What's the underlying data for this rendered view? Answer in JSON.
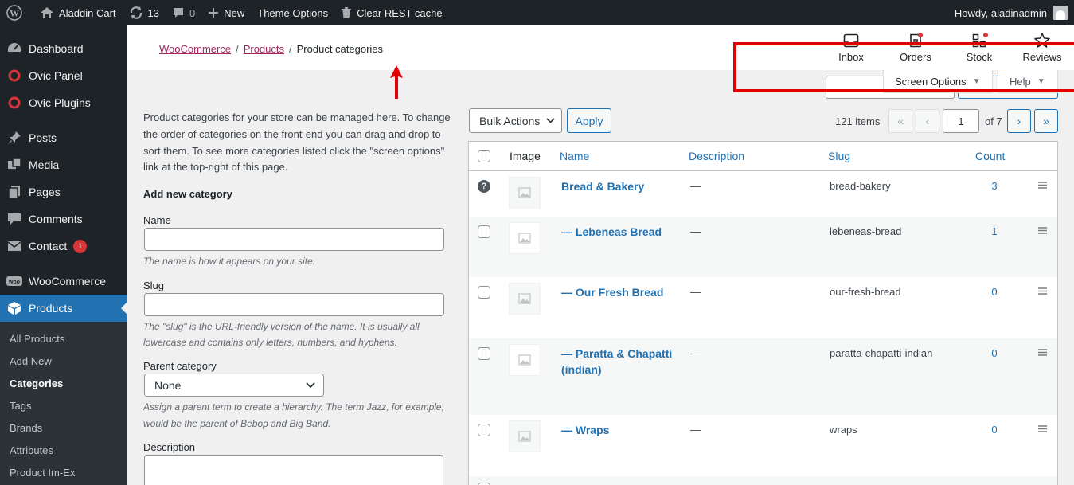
{
  "admin_bar": {
    "site_name": "Aladdin Cart",
    "updates_count": "13",
    "comments_count": "0",
    "new_label": "New",
    "theme_options": "Theme Options",
    "clear_cache": "Clear REST cache",
    "greeting": "Howdy, aladinadmin"
  },
  "sidebar": {
    "items": [
      {
        "label": "Dashboard",
        "icon": "dashboard-icon"
      },
      {
        "label": "Ovic Panel",
        "icon": "ovic-icon"
      },
      {
        "label": "Ovic Plugins",
        "icon": "ovic-icon"
      },
      {
        "label": "Posts",
        "icon": "pin-icon"
      },
      {
        "label": "Media",
        "icon": "media-icon"
      },
      {
        "label": "Pages",
        "icon": "pages-icon"
      },
      {
        "label": "Comments",
        "icon": "comment-icon"
      },
      {
        "label": "Contact",
        "icon": "mail-icon",
        "badge": "1"
      },
      {
        "label": "WooCommerce",
        "icon": "woo-icon"
      },
      {
        "label": "Products",
        "icon": "box-icon"
      }
    ],
    "submenu": [
      "All Products",
      "Add New",
      "Categories",
      "Tags",
      "Brands",
      "Attributes",
      "Product Im-Ex"
    ]
  },
  "header": {
    "breadcrumb": [
      "WooCommerce",
      "Products",
      "Product categories"
    ],
    "icons": [
      {
        "label": "Inbox",
        "icon": "inbox-icon"
      },
      {
        "label": "Orders",
        "icon": "orders-icon"
      },
      {
        "label": "Stock",
        "icon": "stock-icon"
      },
      {
        "label": "Reviews",
        "icon": "star-icon"
      }
    ],
    "screen_options": "Screen Options",
    "help": "Help"
  },
  "form": {
    "intro": "Product categories for your store can be managed here. To change the order of categories on the front-end you can drag and drop to sort them. To see more categories listed click the \"screen options\" link at the top-right of this page.",
    "heading": "Add new category",
    "name_label": "Name",
    "name_desc": "The name is how it appears on your site.",
    "slug_label": "Slug",
    "slug_desc": "The \"slug\" is the URL-friendly version of the name. It is usually all lowercase and contains only letters, numbers, and hyphens.",
    "parent_label": "Parent category",
    "parent_value": "None",
    "parent_desc": "Assign a parent term to create a hierarchy. The term Jazz, for example, would be the parent of Bebop and Big Band.",
    "description_label": "Description"
  },
  "table": {
    "bulk_actions": "Bulk Actions",
    "apply": "Apply",
    "items_count": "121 items",
    "first_page": "«",
    "prev_page": "‹",
    "current_page": "1",
    "of_pages": "of 7",
    "next_page": "›",
    "last_page": "»",
    "columns": [
      "Image",
      "Name",
      "Description",
      "Slug",
      "Count"
    ],
    "rows": [
      {
        "name": "Bread & Bakery",
        "description": "—",
        "slug": "bread-bakery",
        "count": "3"
      },
      {
        "name": "— Lebeneas Bread",
        "description": "—",
        "slug": "lebeneas-bread",
        "count": "1"
      },
      {
        "name": "— Our Fresh Bread",
        "description": "—",
        "slug": "our-fresh-bread",
        "count": "0"
      },
      {
        "name": "— Paratta & Chapatti (indian)",
        "description": "—",
        "slug": "paratta-chapatti-indian",
        "count": "0"
      },
      {
        "name": "— Wraps",
        "description": "—",
        "slug": "wraps",
        "count": "0"
      }
    ]
  },
  "colors": {
    "admin_dark": "#1d2327",
    "wp_blue": "#2271b1",
    "woo_link": "#a2295f",
    "annotation_red": "#e20000"
  }
}
